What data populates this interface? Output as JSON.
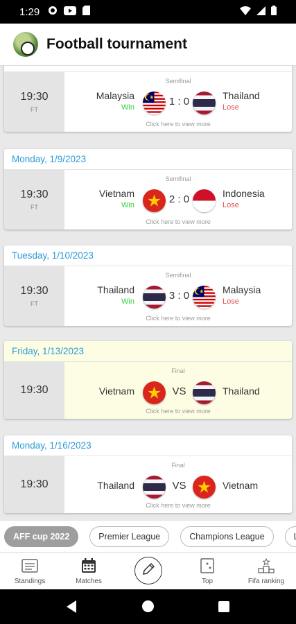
{
  "status": {
    "time": "1:29"
  },
  "app": {
    "title": "Football tournament"
  },
  "matches": [
    {
      "date": "",
      "time": "19:30",
      "status": "FT",
      "round": "Semifinal",
      "home": "Malaysia",
      "home_flag": "malaysia",
      "home_result": "Win",
      "score": "1 : 0",
      "away": "Thailand",
      "away_flag": "thailand",
      "away_result": "Lose",
      "more": "Click here to view more"
    },
    {
      "date": "Monday, 1/9/2023",
      "time": "19:30",
      "status": "FT",
      "round": "Semifinal",
      "home": "Vietnam",
      "home_flag": "vietnam",
      "home_result": "Win",
      "score": "2 : 0",
      "away": "Indonesia",
      "away_flag": "indonesia",
      "away_result": "Lose",
      "more": "Click here to view more"
    },
    {
      "date": "Tuesday, 1/10/2023",
      "time": "19:30",
      "status": "FT",
      "round": "Semifinal",
      "home": "Thailand",
      "home_flag": "thailand",
      "home_result": "Win",
      "score": "3 : 0",
      "away": "Malaysia",
      "away_flag": "malaysia",
      "away_result": "Lose",
      "more": "Click here to view more"
    },
    {
      "date": "Friday, 1/13/2023",
      "time": "19:30",
      "round": "Final",
      "home": "Vietnam",
      "home_flag": "vietnam",
      "score": "VS",
      "away": "Thailand",
      "away_flag": "thailand",
      "more": "Click here to view more"
    },
    {
      "date": "Monday, 1/16/2023",
      "time": "19:30",
      "round": "Final",
      "home": "Thailand",
      "home_flag": "thailand",
      "score": "VS",
      "away": "Vietnam",
      "away_flag": "vietnam",
      "more": "Click here to view more"
    }
  ],
  "tabs": [
    "AFF cup 2022",
    "Premier League",
    "Champions League",
    "La Liga"
  ],
  "active_tab": "AFF cup 2022",
  "nav": {
    "standings": "Standings",
    "matches": "Matches",
    "top": "Top",
    "fifa": "Fifa ranking"
  },
  "colors": {
    "date_blue": "#2a9ad6",
    "win": "#3ccf3c",
    "lose": "#e25050",
    "highlight": "#fdfde3"
  }
}
